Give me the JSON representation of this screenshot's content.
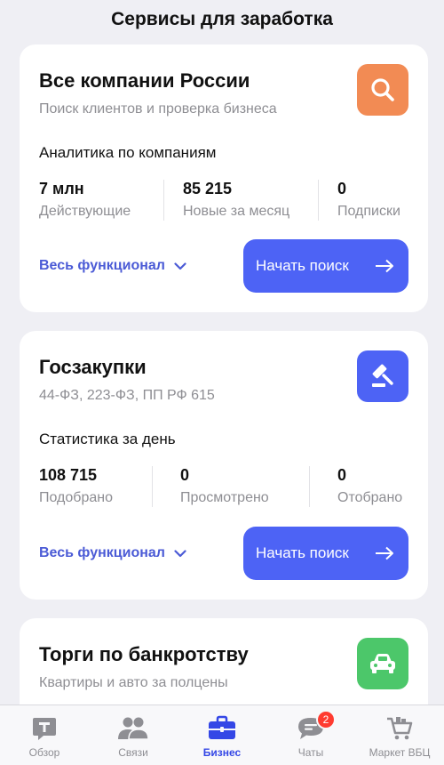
{
  "page": {
    "title": "Сервисы для заработка"
  },
  "cards": [
    {
      "title": "Все компании России",
      "subtitle": "Поиск клиентов и проверка бизнеса",
      "icon": "search-icon",
      "icon_color": "#f28b54",
      "section_label": "Аналитика по компаниям",
      "stats": [
        {
          "value": "7 млн",
          "label": "Действующие"
        },
        {
          "value": "85 215",
          "label": "Новые за месяц"
        },
        {
          "value": "0",
          "label": "Подписки"
        }
      ],
      "more_label": "Весь функционал",
      "cta_label": "Начать поиск"
    },
    {
      "title": "Госзакупки",
      "subtitle": "44-ФЗ, 223-ФЗ, ПП РФ 615",
      "icon": "gavel-icon",
      "icon_color": "#4d63f5",
      "section_label": "Статистика за день",
      "stats": [
        {
          "value": "108 715",
          "label": "Подобрано"
        },
        {
          "value": "0",
          "label": "Просмотрено"
        },
        {
          "value": "0",
          "label": "Отобрано"
        }
      ],
      "more_label": "Весь функционал",
      "cta_label": "Начать поиск"
    },
    {
      "title": "Торги по банкротству",
      "subtitle": "Квартиры и авто за полцены",
      "icon": "car-icon",
      "icon_color": "#4cc76a"
    }
  ],
  "tabbar": {
    "active_color": "#3447e6",
    "items": [
      {
        "label": "Обзор",
        "icon": "overview-icon"
      },
      {
        "label": "Связи",
        "icon": "contacts-icon"
      },
      {
        "label": "Бизнес",
        "icon": "briefcase-icon",
        "active": true
      },
      {
        "label": "Чаты",
        "icon": "chat-icon",
        "badge": "2"
      },
      {
        "label": "Маркет ВБЦ",
        "icon": "cart-icon"
      }
    ]
  }
}
